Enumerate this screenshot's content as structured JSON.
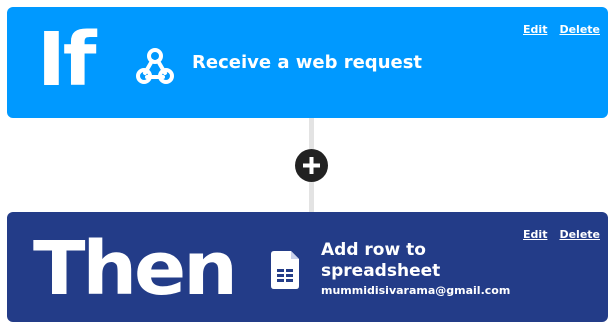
{
  "trigger": {
    "keyword": "If",
    "service_icon": "webhook-icon",
    "label": "Receive a web request",
    "edit_label": "Edit",
    "delete_label": "Delete",
    "background_color": "#0099ff"
  },
  "connector": {
    "add_icon": "plus-icon"
  },
  "action": {
    "keyword": "Then",
    "service_icon": "spreadsheet-icon",
    "label": "Add row to spreadsheet",
    "account": "mummidisivarama@gmail.com",
    "edit_label": "Edit",
    "delete_label": "Delete",
    "background_color": "#233c88"
  }
}
